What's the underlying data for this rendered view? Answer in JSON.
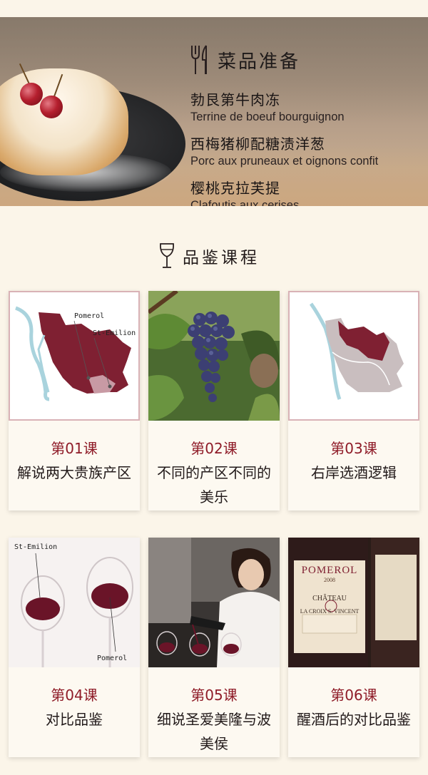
{
  "menu": {
    "title": "菜品准备",
    "icon": "fork-knife-icon",
    "dishes": [
      {
        "cn": "勃艮第牛肉冻",
        "fr": "Terrine de boeuf bourguignon"
      },
      {
        "cn": "西梅猪柳配糖渍洋葱",
        "fr": "Porc aux pruneaux et oignons confit"
      },
      {
        "cn": "樱桃克拉芙提",
        "fr": "Clafoutis aux cerises"
      }
    ]
  },
  "course": {
    "title": "品鉴课程",
    "icon": "wine-glass-icon",
    "cards": [
      {
        "num": "第01课",
        "desc": "解说两大贵族产区",
        "labels": [
          "Pomerol",
          "St-Emilion"
        ]
      },
      {
        "num": "第02课",
        "desc": "不同的产区不同的美乐"
      },
      {
        "num": "第03课",
        "desc": "右岸选酒逻辑"
      },
      {
        "num": "第04课",
        "desc": "对比品鉴",
        "labels": [
          "St-Emilion",
          "Pomerol"
        ]
      },
      {
        "num": "第05课",
        "desc": "细说圣爱美隆与波美侯"
      },
      {
        "num": "第06课",
        "desc": "醒酒后的对比品鉴",
        "bottle_label": [
          "POMEROL",
          "2008",
          "CHÂTEAU",
          "LA CROIX S. VINCENT"
        ]
      }
    ]
  },
  "colors": {
    "accent": "#8f1c28",
    "map_fill": "#7f2032",
    "background": "#fbf5e9"
  }
}
